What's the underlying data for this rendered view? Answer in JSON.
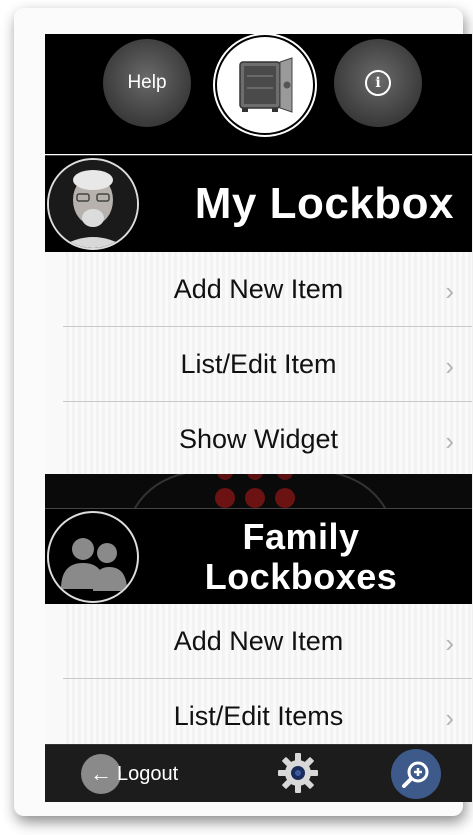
{
  "top": {
    "help_label": "Help",
    "safe_icon": "safe-icon",
    "info_icon": "info-icon",
    "info_glyph": "i"
  },
  "my_lockbox": {
    "title": "My Lockbox",
    "avatar": "user-avatar",
    "items": [
      {
        "label": "Add New Item"
      },
      {
        "label": "List/Edit Item"
      },
      {
        "label": "Show Widget"
      }
    ]
  },
  "family": {
    "title_line1": "Family",
    "title_line2": "Lockboxes",
    "avatar": "group-avatar",
    "items": [
      {
        "label": "Add New Item"
      },
      {
        "label": "List/Edit Items"
      }
    ]
  },
  "bottom": {
    "logout_label": "Logout",
    "back_icon": "arrow-left-icon",
    "settings_icon": "gear-icon",
    "search_icon": "zoom-icon"
  },
  "colors": {
    "header_bg": "#000000",
    "menu_bg": "#f9f9f9",
    "chevron": "#b5b5b5",
    "search_btn": "#3d5a8a"
  }
}
